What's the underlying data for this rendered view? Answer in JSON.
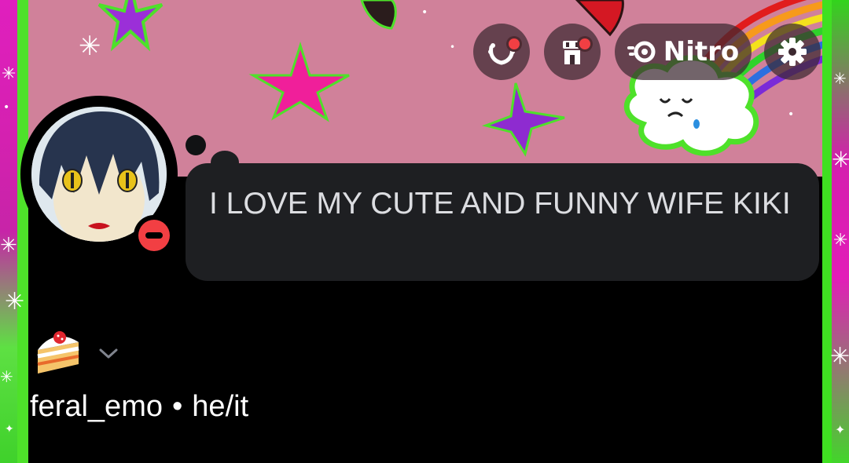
{
  "header": {
    "buttons": [
      {
        "name": "wreath-icon",
        "has_notification": true
      },
      {
        "name": "shop-icon",
        "has_notification": true
      },
      {
        "name": "nitro-icon",
        "label": "Nitro"
      },
      {
        "name": "gear-icon"
      }
    ]
  },
  "profile": {
    "status_type": "do-not-disturb",
    "custom_status": "I LOVE MY CUTE AND FUNNY WIFE KIKI",
    "status_emoji": "cake-slice-icon",
    "username": "feral_emo",
    "separator": "•",
    "pronouns": "he/it"
  },
  "colors": {
    "banner": "#d0819a",
    "frame_pink": "#e01fbe",
    "frame_green": "#4ee12a",
    "bubble": "#1e1f22",
    "dnd_red": "#f23f43"
  }
}
